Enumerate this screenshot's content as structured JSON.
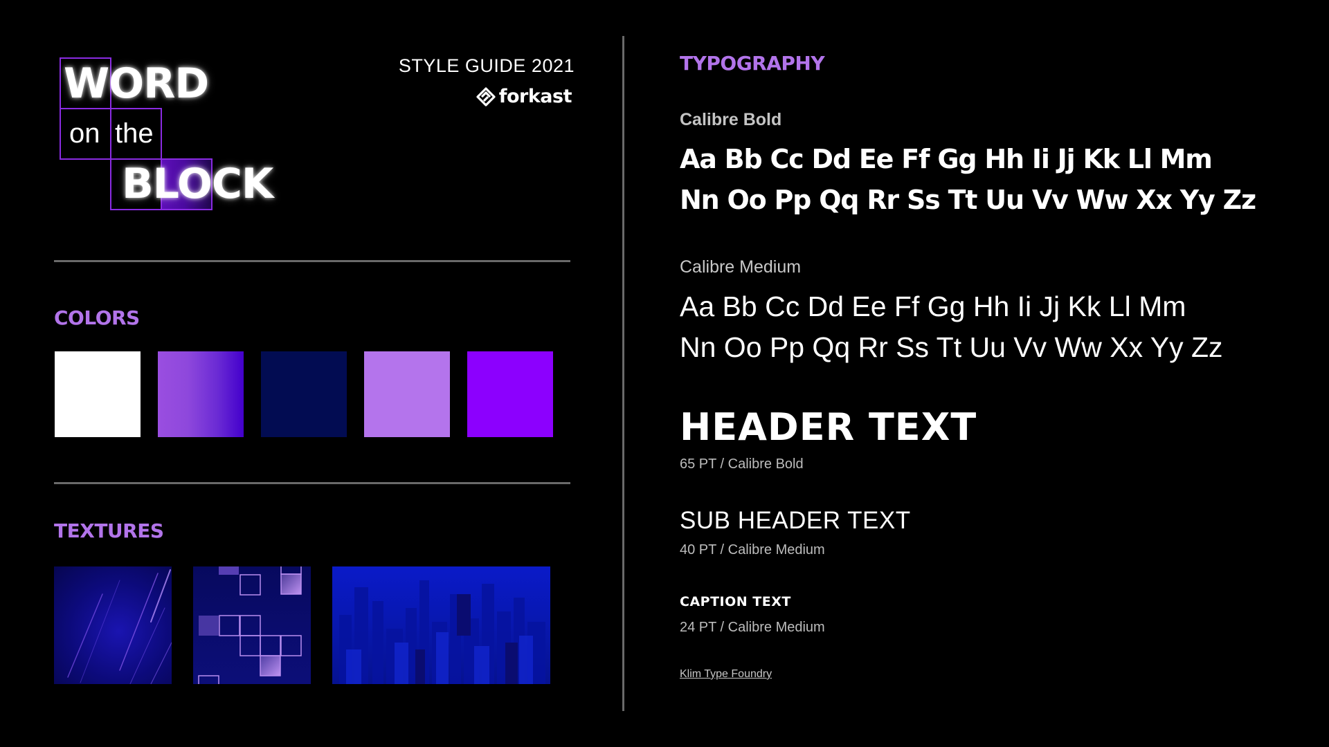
{
  "logo": {
    "line1": "WORD",
    "line2_left": "on",
    "line2_right": "the",
    "line3": "BLOCK"
  },
  "header": {
    "title": "STYLE GUIDE 2021",
    "brand": "forkast",
    "brand_icon": "forkast-logo-icon"
  },
  "colors": {
    "label": "COLORS",
    "swatches": [
      {
        "name": "white",
        "hex": "#ffffff"
      },
      {
        "name": "purple-gradient",
        "hex_from": "#9a4ee0",
        "hex_to": "#4a00d0"
      },
      {
        "name": "navy",
        "hex": "#020c52"
      },
      {
        "name": "lavender",
        "hex": "#b474ec"
      },
      {
        "name": "violet",
        "hex": "#8c00fe"
      }
    ]
  },
  "textures": {
    "label": "TEXTURES",
    "items": [
      {
        "name": "light-streaks"
      },
      {
        "name": "block-grid"
      },
      {
        "name": "city-skyline"
      }
    ]
  },
  "typography": {
    "label": "TYPOGRAPHY",
    "fonts": [
      {
        "name": "Calibre Bold",
        "line1": "Aa Bb Cc Dd Ee Ff Gg Hh Ii Jj Kk Ll Mm",
        "line2": "Nn Oo Pp Qq Rr Ss Tt Uu Vv Ww Xx Yy Zz"
      },
      {
        "name": "Calibre Medium",
        "line1": "Aa Bb Cc Dd Ee Ff Gg Hh Ii Jj Kk Ll Mm",
        "line2": "Nn Oo Pp Qq Rr Ss Tt Uu Vv Ww Xx Yy Zz"
      }
    ],
    "styles": [
      {
        "sample": "HEADER TEXT",
        "spec": "65 PT / Calibre Bold"
      },
      {
        "sample": "SUB HEADER TEXT",
        "spec": "40 PT / Calibre Medium"
      },
      {
        "sample": "CAPTION TEXT",
        "spec": "24 PT / Calibre Medium"
      }
    ],
    "credit_link": "Klim Type Foundry"
  }
}
